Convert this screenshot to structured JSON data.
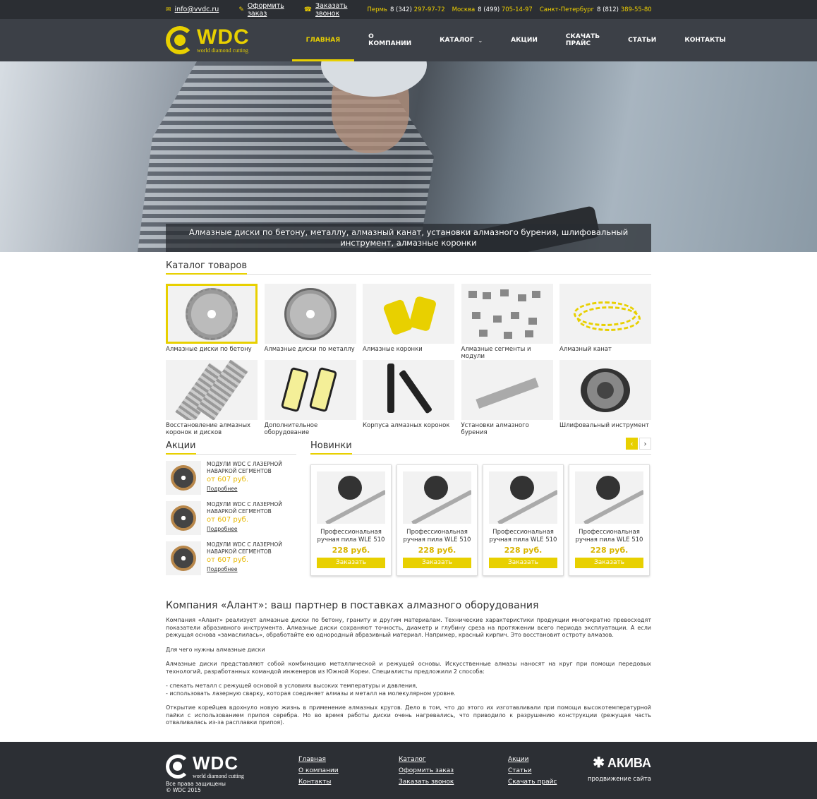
{
  "topbar": {
    "email": "info@vvdc.ru",
    "order": "Оформить заказ",
    "callback": "Заказать звонок",
    "phones": [
      {
        "city": "Пермь",
        "code": "8 (342)",
        "number": "297-97-72"
      },
      {
        "city": "Москва",
        "code": "8 (499)",
        "number": "705-14-97"
      },
      {
        "city": "Санкт-Петербург",
        "code": "8 (812)",
        "number": "389-55-80"
      }
    ]
  },
  "logo": {
    "name": "WDC",
    "tagline": "world diamond cutting"
  },
  "nav": [
    {
      "label": "ГЛАВНАЯ"
    },
    {
      "label": "О КОМПАНИИ"
    },
    {
      "label": "КАТАЛОГ"
    },
    {
      "label": "АКЦИИ"
    },
    {
      "label": "СКАЧАТЬ ПРАЙС"
    },
    {
      "label": "СТАТЬИ"
    },
    {
      "label": "КОНТАКТЫ"
    }
  ],
  "hero": {
    "caption": "Алмазные диски по бетону, металлу, алмазный канат, установки алмазного бурения, шлифовальный инструмент, алмазные коронки"
  },
  "catalog": {
    "title": "Каталог товаров",
    "items": [
      {
        "label": "Алмазные диски по бетону"
      },
      {
        "label": "Алмазные диски по металлу"
      },
      {
        "label": "Алмазные коронки"
      },
      {
        "label": "Алмазные сегменты и модули"
      },
      {
        "label": "Алмазный канат"
      },
      {
        "label": "Восстановление алмазных коронок и дисков"
      },
      {
        "label": "Дополнительное оборудование"
      },
      {
        "label": "Корпуса алмазных коронок"
      },
      {
        "label": "Установки алмазного бурения"
      },
      {
        "label": "Шлифовальный инструмент"
      }
    ]
  },
  "akcii": {
    "title": "Акции",
    "items": [
      {
        "name": "МОДУЛИ WDC С ЛАЗЕРНОЙ НАВАРКОЙ СЕГМЕНТОВ",
        "price": "от 607 руб.",
        "more": "Подробнее"
      },
      {
        "name": "МОДУЛИ WDC С ЛАЗЕРНОЙ НАВАРКОЙ СЕГМЕНТОВ",
        "price": "от 607 руб.",
        "more": "Подробнее"
      },
      {
        "name": "МОДУЛИ WDC С ЛАЗЕРНОЙ НАВАРКОЙ СЕГМЕНТОВ",
        "price": "от 607 руб.",
        "more": "Подробнее"
      }
    ]
  },
  "news": {
    "title": "Новинки",
    "prev": "‹",
    "next": "›",
    "items": [
      {
        "name": "Профессиональная ручная пила WLE 510",
        "price": "228 руб.",
        "button": "Заказать"
      },
      {
        "name": "Профессиональная ручная пила WLE 510",
        "price": "228 руб.",
        "button": "Заказать"
      },
      {
        "name": "Профессиональная ручная пила WLE 510",
        "price": "228 руб.",
        "button": "Заказать"
      },
      {
        "name": "Профессиональная ручная пила WLE 510",
        "price": "228 руб.",
        "button": "Заказать"
      }
    ]
  },
  "about": {
    "title": "Компания «Алант»: ваш партнер в поставках алмазного оборудования",
    "p1": "Компания «Алант» реализует алмазные диски по бетону, граниту и другим материалам. Технические характеристики продукции многократно превосходят показатели абразивного инструмента. Алмазные диски сохраняют точность, диаметр и глубину среза на протяжении всего периода эксплуатации. А если режущая основа «замаслилась», обработайте ею однородный абразивный материал. Например, красный кирпич. Это восстановит остроту алмазов.",
    "p2": "Для чего нужны алмазные диски",
    "p3": "Алмазные диски представляют собой комбинацию металлической и режущей основы. Искусственные алмазы наносят на круг при помощи передовых технологий, разработанных командой инженеров из Южной Кореи. Специалисты предложили 2 способа:",
    "p4a": "- спекать металл с режущей основой в условиях высоких температуры и давления,",
    "p4b": "- использовать лазерную сварку, которая соединяет алмазы и металл на молекулярном уровне.",
    "p5": "Открытие корейцев вдохнуло новую жизнь в применение алмазных кругов. Дело в том, что до этого их изготавливали при помощи высокотемпературной пайки с использованием припоя серебра. Но во время работы диски очень нагревались, что приводило к разрушению конструкции (режущая часть отваливалась из-за расплавки припоя)."
  },
  "footer": {
    "rights": "Все права защищены",
    "copy": "© WDC 2015",
    "col1": [
      "Главная",
      "О компании",
      "Контакты"
    ],
    "col2": [
      "Каталог",
      "Оформить заказ",
      "Заказать звонок"
    ],
    "col3": [
      "Акции",
      "Статьи",
      "Скачать прайс"
    ],
    "agency": "АКИВА",
    "agency_sub": "продвижение сайта"
  },
  "colors": {
    "accent": "#e8d000",
    "dark": "#2b2e33",
    "header": "#3c4047"
  }
}
